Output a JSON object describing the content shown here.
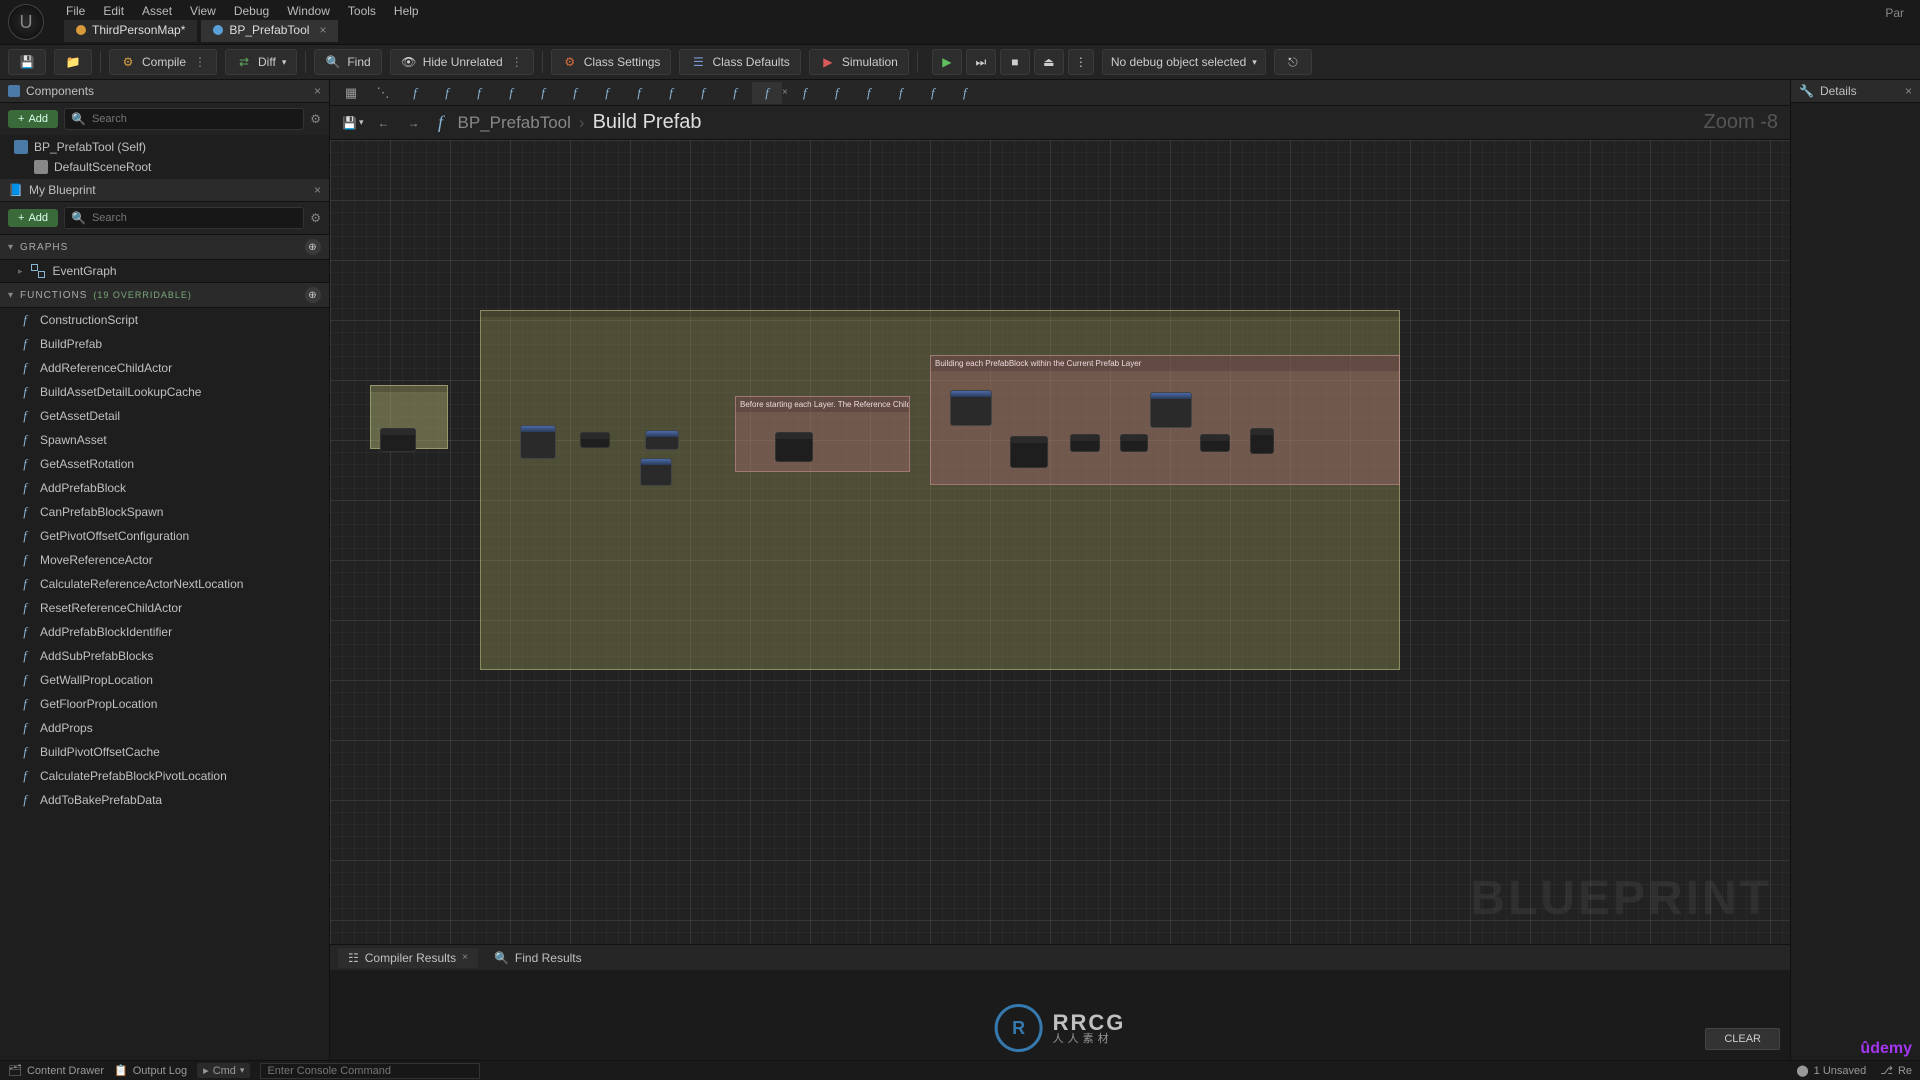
{
  "menubar": {
    "items": [
      "File",
      "Edit",
      "Asset",
      "View",
      "Debug",
      "Window",
      "Tools",
      "Help"
    ],
    "right_label": "Par"
  },
  "doc_tabs": [
    {
      "label": "ThirdPersonMap*",
      "icon": "orange",
      "active": false
    },
    {
      "label": "BP_PrefabTool",
      "icon": "blue",
      "active": true
    }
  ],
  "toolbar": {
    "compile": "Compile",
    "diff": "Diff",
    "find": "Find",
    "hide_unrelated": "Hide Unrelated",
    "class_settings": "Class Settings",
    "class_defaults": "Class Defaults",
    "simulation": "Simulation",
    "debug_select": "No debug object selected"
  },
  "components": {
    "title": "Components",
    "add": "Add",
    "search_placeholder": "Search",
    "items": [
      {
        "label": "BP_PrefabTool (Self)",
        "indent": 0,
        "type": "bp"
      },
      {
        "label": "DefaultSceneRoot",
        "indent": 1,
        "type": "scene"
      }
    ]
  },
  "myblueprint": {
    "title": "My Blueprint",
    "add": "Add",
    "search_placeholder": "Search",
    "graphs_header": "GRAPHS",
    "event_graph": "EventGraph",
    "functions_header": "FUNCTIONS",
    "functions_count": "(19 OVERRIDABLE)",
    "functions": [
      "ConstructionScript",
      "BuildPrefab",
      "AddReferenceChildActor",
      "BuildAssetDetailLookupCache",
      "GetAssetDetail",
      "SpawnAsset",
      "GetAssetRotation",
      "AddPrefabBlock",
      "CanPrefabBlockSpawn",
      "GetPivotOffsetConfiguration",
      "MoveReferenceActor",
      "CalculateReferenceActorNextLocation",
      "ResetReferenceChildActor",
      "AddPrefabBlockIdentifier",
      "AddSubPrefabBlocks",
      "GetWallPropLocation",
      "GetFloorPropLocation",
      "AddProps",
      "BuildPivotOffsetCache",
      "CalculatePrefabBlockPivotLocation",
      "AddToBakePrefabData"
    ]
  },
  "graph": {
    "breadcrumb_root": "BP_PrefabTool",
    "breadcrumb_current": "Build Prefab",
    "zoom": "Zoom -8",
    "watermark": "BLUEPRINT",
    "comment1": "",
    "comment2": "Before starting each Layer. The Reference Child Actor will be reset to the Starting Position.",
    "comment3": "Building each PrefabBlock within the Current Prefab Layer"
  },
  "bottom": {
    "compiler_results": "Compiler Results",
    "find_results": "Find Results",
    "clear": "CLEAR"
  },
  "details": {
    "title": "Details"
  },
  "watermark": {
    "big": "RRCG",
    "small": "人人素材"
  },
  "udemy": "ûdemy",
  "statusbar": {
    "content_drawer": "Content Drawer",
    "output_log": "Output Log",
    "cmd": "Cmd",
    "cmd_placeholder": "Enter Console Command",
    "unsaved": "1 Unsaved",
    "rev": "Re"
  }
}
